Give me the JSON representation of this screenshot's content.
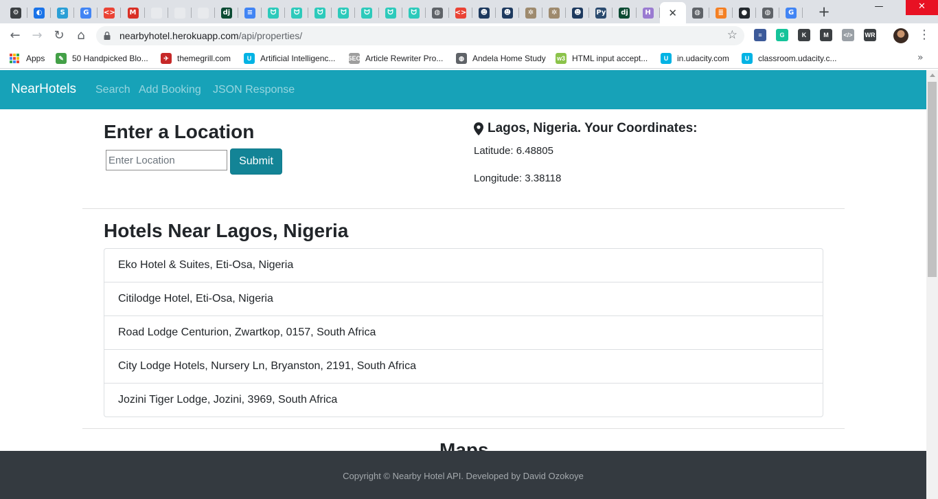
{
  "browser": {
    "tabs": [
      {
        "name": "tab-gear",
        "glyph": "⚙",
        "color": "#3c4043"
      },
      {
        "name": "tab-cloud",
        "glyph": "◐",
        "color": "#1a73e8"
      },
      {
        "name": "tab-s",
        "glyph": "S",
        "color": "#2b9fd6"
      },
      {
        "name": "tab-google",
        "glyph": "G",
        "color": "#4285f4"
      },
      {
        "name": "tab-code",
        "glyph": "<>",
        "color": "#ea4335"
      },
      {
        "name": "tab-gmail",
        "glyph": "M",
        "color": "#d93025"
      },
      {
        "name": "tab-blank-1",
        "glyph": "",
        "color": "#e8eaed"
      },
      {
        "name": "tab-blank-2",
        "glyph": "",
        "color": "#e8eaed"
      },
      {
        "name": "tab-blank-3",
        "glyph": "",
        "color": "#e8eaed"
      },
      {
        "name": "tab-django",
        "glyph": "dj",
        "color": "#0c4b33"
      },
      {
        "name": "tab-docs",
        "glyph": "≡",
        "color": "#4285f4"
      },
      {
        "name": "tab-scrimba-1",
        "glyph": "ᗢ",
        "color": "#2dcabb"
      },
      {
        "name": "tab-scrimba-2",
        "glyph": "ᗢ",
        "color": "#2dcabb"
      },
      {
        "name": "tab-scrimba-3",
        "glyph": "ᗢ",
        "color": "#2dcabb"
      },
      {
        "name": "tab-scrimba-4",
        "glyph": "ᗢ",
        "color": "#2dcabb"
      },
      {
        "name": "tab-scrimba-5",
        "glyph": "ᗢ",
        "color": "#2dcabb"
      },
      {
        "name": "tab-scrimba-6",
        "glyph": "ᗢ",
        "color": "#2dcabb"
      },
      {
        "name": "tab-scrimba-7",
        "glyph": "ᗢ",
        "color": "#2dcabb"
      },
      {
        "name": "tab-globe-1",
        "glyph": "◍",
        "color": "#5f6368"
      },
      {
        "name": "tab-code-2",
        "glyph": "<>",
        "color": "#ea4335"
      },
      {
        "name": "tab-avatar-1",
        "glyph": "☻",
        "color": "#1e3a5f"
      },
      {
        "name": "tab-avatar-2",
        "glyph": "☻",
        "color": "#1e3a5f"
      },
      {
        "name": "tab-cog-1",
        "glyph": "✲",
        "color": "#9e8a6e"
      },
      {
        "name": "tab-cog-2",
        "glyph": "✲",
        "color": "#9e8a6e"
      },
      {
        "name": "tab-avatar-3",
        "glyph": "☻",
        "color": "#1e3a5f"
      },
      {
        "name": "tab-python",
        "glyph": "Py",
        "color": "#2b4b6f"
      },
      {
        "name": "tab-django-2",
        "glyph": "dj",
        "color": "#0c4b33"
      },
      {
        "name": "tab-heroku",
        "glyph": "H",
        "color": "#9a7bd1"
      }
    ],
    "active_tab_close": "✕",
    "tabs_after": [
      {
        "name": "tab-globe-2",
        "glyph": "◍",
        "color": "#5f6368"
      },
      {
        "name": "tab-stackoverflow",
        "glyph": "≣",
        "color": "#f48024"
      },
      {
        "name": "tab-github",
        "glyph": "●",
        "color": "#24292e"
      },
      {
        "name": "tab-globe-3",
        "glyph": "◍",
        "color": "#5f6368"
      },
      {
        "name": "tab-google-2",
        "glyph": "G",
        "color": "#4285f4"
      }
    ],
    "new_tab": "+",
    "window_controls": {
      "minimize": "—",
      "restore": "❐",
      "close": "✕"
    },
    "nav": {
      "back": "←",
      "forward": "→",
      "reload": "↻",
      "home": "⌂"
    },
    "url_host": "nearbyhotel.herokuapp.com",
    "url_path": "/api/properties/",
    "bookmark_star": "☆",
    "extensions": [
      {
        "name": "ext-stack",
        "glyph": "≡",
        "color": "#3c5a99"
      },
      {
        "name": "ext-grammarly",
        "glyph": "G",
        "color": "#15c39a"
      },
      {
        "name": "ext-k",
        "glyph": "K",
        "color": "#3c4043"
      },
      {
        "name": "ext-gmail",
        "glyph": "M",
        "color": "#3c4043"
      },
      {
        "name": "ext-code",
        "glyph": "</>",
        "color": "#9aa0a6"
      },
      {
        "name": "ext-wr",
        "glyph": "WR",
        "color": "#3c4043"
      }
    ],
    "menu": "⋮",
    "bookmarks": [
      {
        "name": "bookmark-apps",
        "label": "Apps",
        "color": ""
      },
      {
        "name": "bookmark-handpicked",
        "label": "50 Handpicked Blo...",
        "color": "#43a047",
        "glyph": "✎"
      },
      {
        "name": "bookmark-themegrill",
        "label": "themegrill.com",
        "color": "#c62828",
        "glyph": "✈"
      },
      {
        "name": "bookmark-ai",
        "label": "Artificial Intelligenc...",
        "color": "#02b3e4",
        "glyph": "U"
      },
      {
        "name": "bookmark-article-rewriter",
        "label": "Article Rewriter Pro...",
        "color": "#9e9e9e",
        "glyph": "SEO"
      },
      {
        "name": "bookmark-andela",
        "label": "Andela Home Study",
        "color": "#5f6368",
        "glyph": "◍"
      },
      {
        "name": "bookmark-html-input",
        "label": "HTML input accept...",
        "color": "#8bc34a",
        "glyph": "w3"
      },
      {
        "name": "bookmark-udacity",
        "label": "in.udacity.com",
        "color": "#02b3e4",
        "glyph": "U"
      },
      {
        "name": "bookmark-classroom",
        "label": "classroom.udacity.c...",
        "color": "#02b3e4",
        "glyph": "U"
      }
    ],
    "bookmarks_more": "»"
  },
  "site": {
    "brand": "NearHotels",
    "nav_links": [
      "Search",
      "Add Booking",
      "JSON Response"
    ]
  },
  "search": {
    "heading": "Enter a Location",
    "placeholder": "Enter Location",
    "submit_label": "Submit"
  },
  "coordinates": {
    "title": "Lagos, Nigeria. Your Coordinates:",
    "latitude": "Latitude: 6.48805",
    "longitude": "Longitude: 3.38118"
  },
  "hotels": {
    "heading": "Hotels Near Lagos, Nigeria",
    "items": [
      "Eko Hotel & Suites, Eti-Osa, Nigeria",
      "Citilodge Hotel, Eti-Osa, Nigeria",
      "Road Lodge Centurion, Zwartkop, 0157, South Africa",
      "City Lodge Hotels, Nursery Ln, Bryanston, 2191, South Africa",
      "Jozini Tiger Lodge, Jozini, 3969, South Africa"
    ]
  },
  "maps_heading": "Maps",
  "footer": "Copyright © Nearby Hotel API. Developed by David Ozokoye"
}
